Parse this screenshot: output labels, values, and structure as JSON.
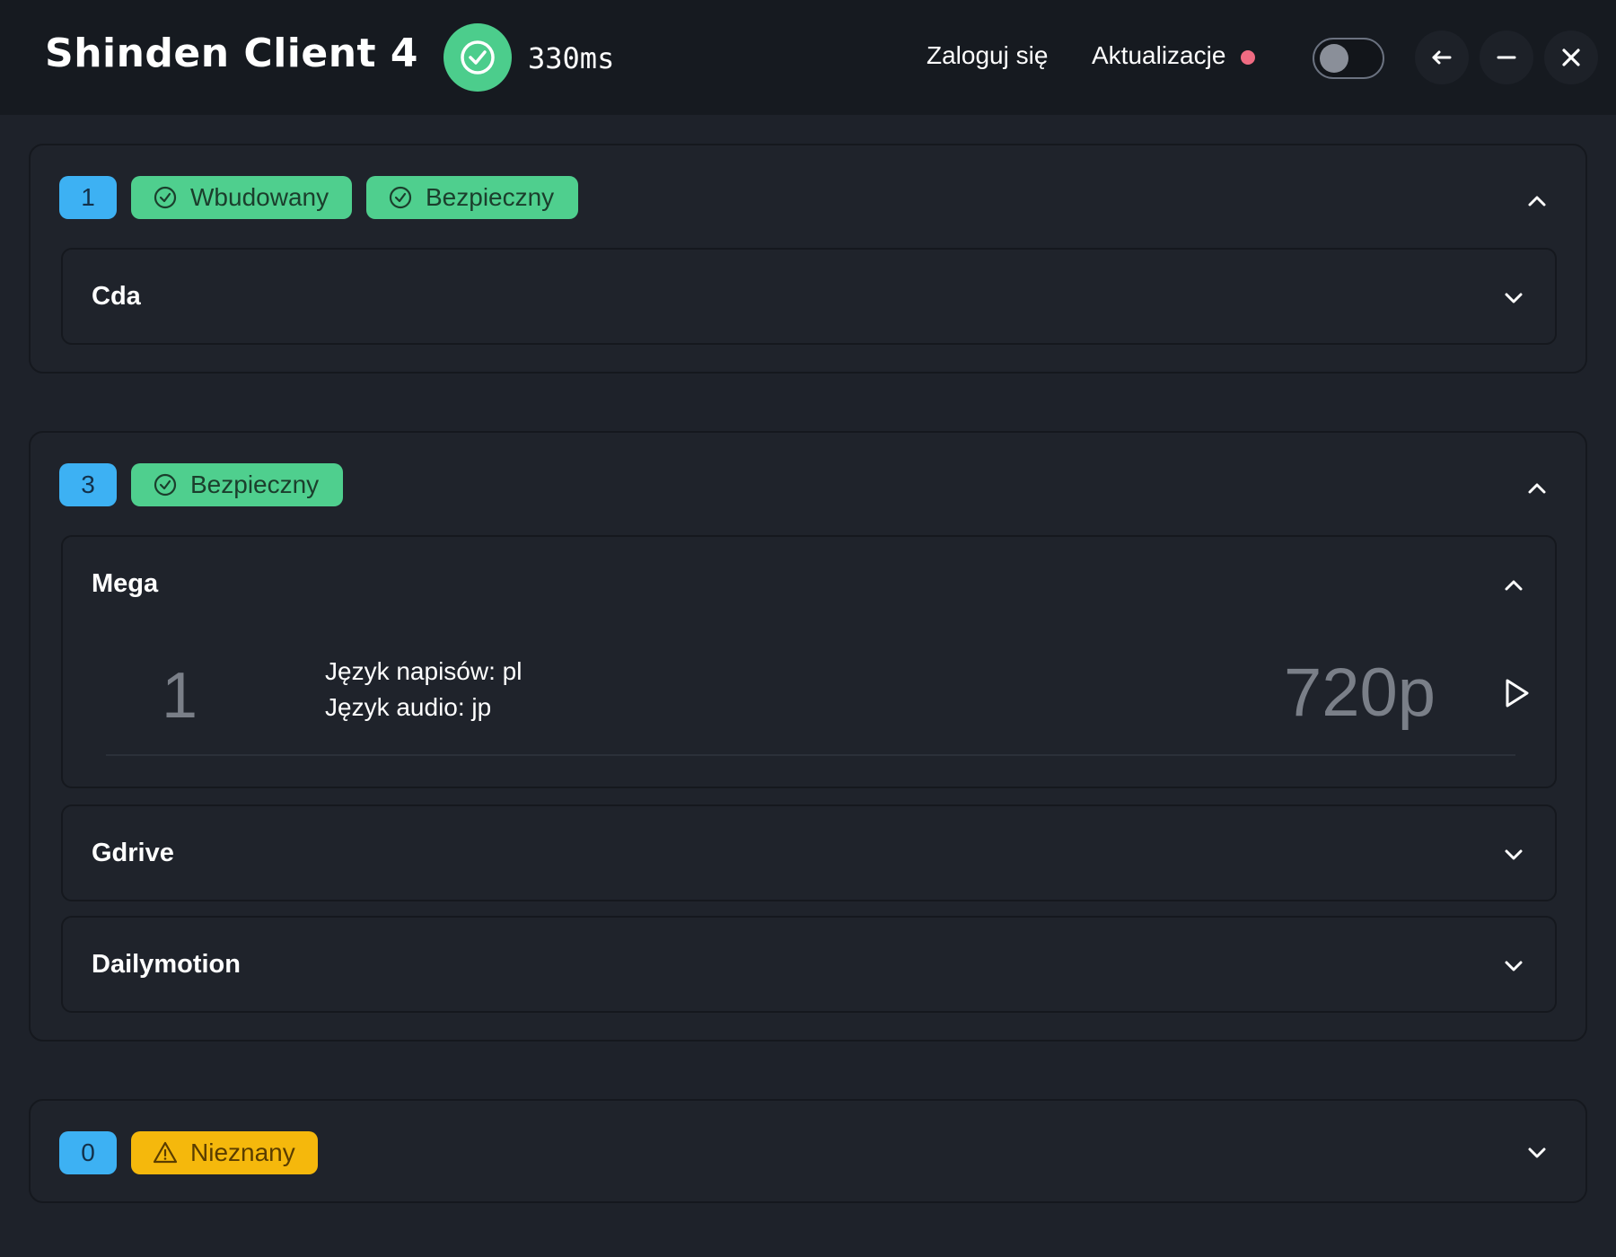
{
  "header": {
    "app_title": "Shinden Client 4",
    "ping": "330ms",
    "login_label": "Zaloguj się",
    "updates_label": "Aktualizacje",
    "theme_toggle_on": false
  },
  "groups": [
    {
      "count": "1",
      "tags": [
        "Wbudowany",
        "Bezpieczny"
      ],
      "expanded": true,
      "hosts": [
        {
          "name": "Cda",
          "expanded": false
        }
      ]
    },
    {
      "count": "3",
      "tags": [
        "Bezpieczny"
      ],
      "expanded": true,
      "hosts": [
        {
          "name": "Mega",
          "expanded": true,
          "episodes": [
            {
              "number": "1",
              "subtitles": "Język napisów: pl",
              "audio": "Język audio: jp",
              "quality": "720p"
            }
          ]
        },
        {
          "name": "Gdrive",
          "expanded": false
        },
        {
          "name": "Dailymotion",
          "expanded": false
        }
      ]
    },
    {
      "count": "0",
      "tags": [
        "Nieznany"
      ],
      "expanded": false,
      "hosts": []
    }
  ],
  "colors": {
    "background": "#1e222a",
    "titlebar": "#161a20",
    "count_badge": "#3db1f3",
    "safe_badge": "#4fcf8e",
    "unknown_badge": "#f5b80c",
    "update_dot": "#f06b82"
  }
}
